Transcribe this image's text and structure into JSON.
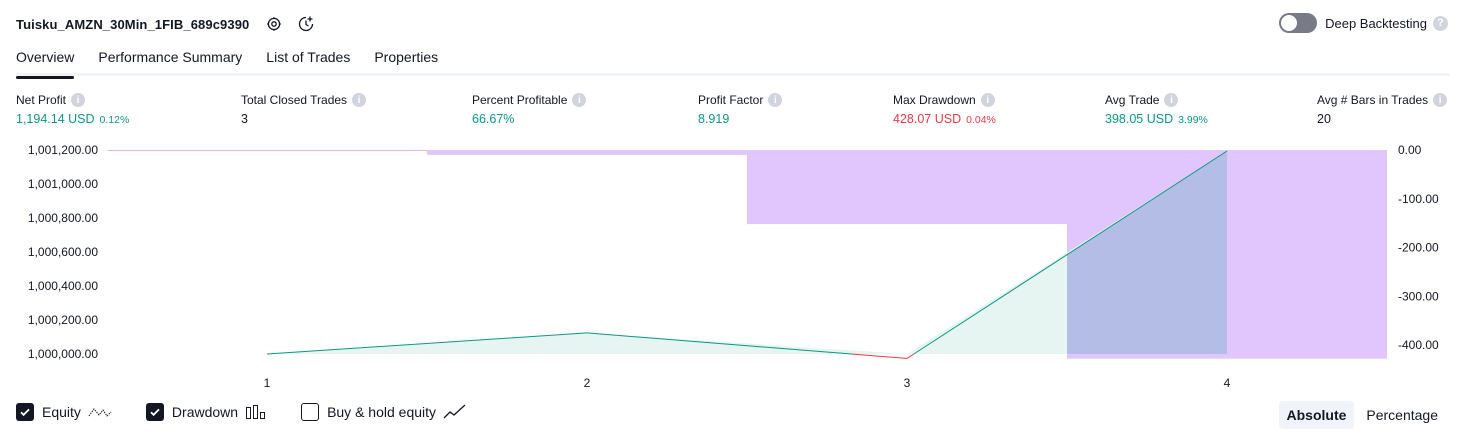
{
  "header": {
    "strategy_name": "Tuisku_AMZN_30Min_1FIB_689c9390",
    "deep_backtesting_label": "Deep Backtesting",
    "deep_backtesting_enabled": false
  },
  "tabs": [
    {
      "label": "Overview",
      "active": true
    },
    {
      "label": "Performance Summary",
      "active": false
    },
    {
      "label": "List of Trades",
      "active": false
    },
    {
      "label": "Properties",
      "active": false
    }
  ],
  "metrics": {
    "net_profit": {
      "label": "Net Profit",
      "value": "1,194.14 USD",
      "pct": "0.12%"
    },
    "total_closed_trades": {
      "label": "Total Closed Trades",
      "value": "3"
    },
    "percent_profitable": {
      "label": "Percent Profitable",
      "value": "66.67%"
    },
    "profit_factor": {
      "label": "Profit Factor",
      "value": "8.919"
    },
    "max_drawdown": {
      "label": "Max Drawdown",
      "value": "428.07 USD",
      "pct": "0.04%"
    },
    "avg_trade": {
      "label": "Avg Trade",
      "value": "398.05 USD",
      "pct": "3.99%"
    },
    "avg_bars_in_trades": {
      "label": "Avg # Bars in Trades",
      "value": "20"
    }
  },
  "chart_data": {
    "type": "line",
    "x": [
      1,
      2,
      3,
      4
    ],
    "xticks": [
      "1",
      "2",
      "3",
      "4"
    ],
    "equity": [
      1000000.0,
      1000124.0,
      999974.0,
      1001194.14
    ],
    "equity_baseline": 1000000.0,
    "drawdown": [
      {
        "trade": 1,
        "value": 0
      },
      {
        "trade": 2,
        "value": -10
      },
      {
        "trade": 3,
        "value": -152
      },
      {
        "trade": 4,
        "value": -428.07
      }
    ],
    "y_left": {
      "ticks": [
        "1,001,200.00",
        "1,001,000.00",
        "1,000,800.00",
        "1,000,600.00",
        "1,000,400.00",
        "1,000,200.00",
        "1,000,000.00"
      ],
      "range": [
        1000000,
        1001200
      ]
    },
    "y_right": {
      "ticks": [
        "0.00",
        "-100.00",
        "-200.00",
        "-300.00",
        "-400.00"
      ],
      "range": [
        -400,
        0
      ]
    },
    "colors": {
      "equity_up": "#089981",
      "equity_down": "#f23645",
      "equity_fill": "#e3f4f0",
      "drawdown_bar": "#e1c5fd",
      "drawdown_line": "#e3b4d6",
      "overlap": "#b4bde6"
    }
  },
  "legend": {
    "equity": {
      "label": "Equity",
      "checked": true
    },
    "drawdown": {
      "label": "Drawdown",
      "checked": true
    },
    "buy_hold": {
      "label": "Buy & hold equity",
      "checked": false
    }
  },
  "mode": {
    "absolute_label": "Absolute",
    "percentage_label": "Percentage",
    "selected": "Absolute"
  }
}
